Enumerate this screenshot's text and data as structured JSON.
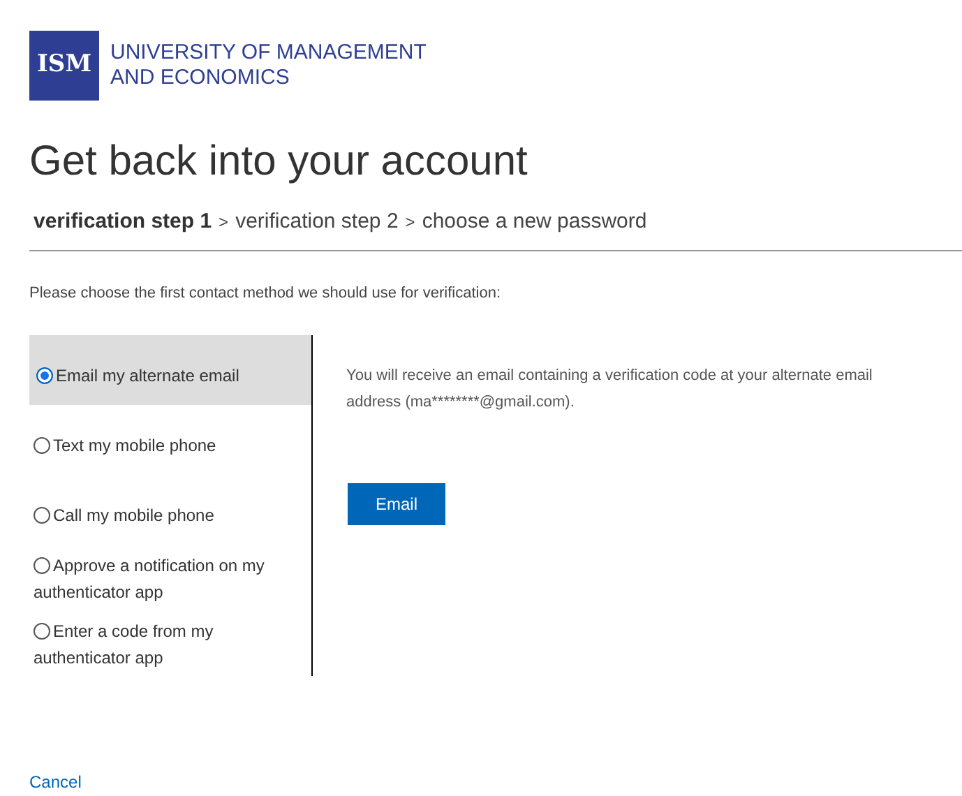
{
  "logo": {
    "mark": "ISM",
    "name_lines": [
      "UNIVERSITY OF MANAGEMENT",
      "AND ECONOMICS"
    ]
  },
  "title": "Get back into your account",
  "steps": {
    "separator": ">",
    "items": [
      {
        "label": "verification step 1",
        "selected": true
      },
      {
        "label": "verification step 2",
        "selected": false
      },
      {
        "label": "choose a new password",
        "selected": false
      }
    ]
  },
  "instructions": "Please choose the first contact method we should use for verification:",
  "methods": [
    {
      "label": "Email my alternate email",
      "selected": true
    },
    {
      "label": "Text my mobile phone",
      "selected": false
    },
    {
      "label": "Call my mobile phone",
      "selected": false
    },
    {
      "label": "Approve a notification on my authenticator app",
      "selected": false
    },
    {
      "label": "Enter a code from my authenticator app",
      "selected": false
    }
  ],
  "detail": {
    "message": "You will receive an email containing a verification code at your alternate email address (ma********@gmail.com).",
    "button": "Email"
  },
  "cancel_link": "Cancel"
}
